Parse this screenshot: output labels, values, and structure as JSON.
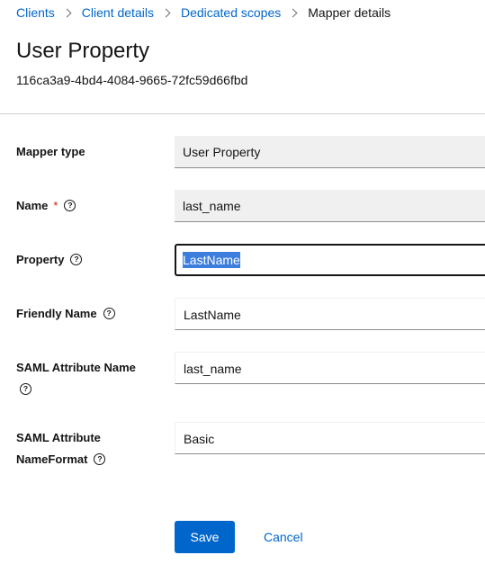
{
  "breadcrumb": {
    "items": [
      "Clients",
      "Client details",
      "Dedicated scopes"
    ],
    "current": "Mapper details"
  },
  "header": {
    "title": "User Property",
    "subtitle": "116ca3a9-4bd4-4084-9665-72fc59d66fbd"
  },
  "form": {
    "mapper_type": {
      "label": "Mapper type",
      "value": "User Property"
    },
    "name": {
      "label": "Name",
      "required_mark": "*",
      "value": "last_name"
    },
    "property": {
      "label": "Property",
      "value": "LastName"
    },
    "friendly_name": {
      "label": "Friendly Name",
      "value": "LastName"
    },
    "saml_attribute_name": {
      "label": "SAML Attribute Name",
      "value": "last_name"
    },
    "saml_attribute_nameformat": {
      "label_line1": "SAML Attribute",
      "label_line2": "NameFormat",
      "value": "Basic"
    },
    "help_glyph": "?"
  },
  "actions": {
    "save_label": "Save",
    "cancel_label": "Cancel"
  },
  "colors": {
    "link": "#0066cc",
    "primary_button": "#0066cc",
    "required": "#c9190b",
    "readonly_field_bg": "#f0f0f0",
    "selection": "#3d7dde"
  }
}
